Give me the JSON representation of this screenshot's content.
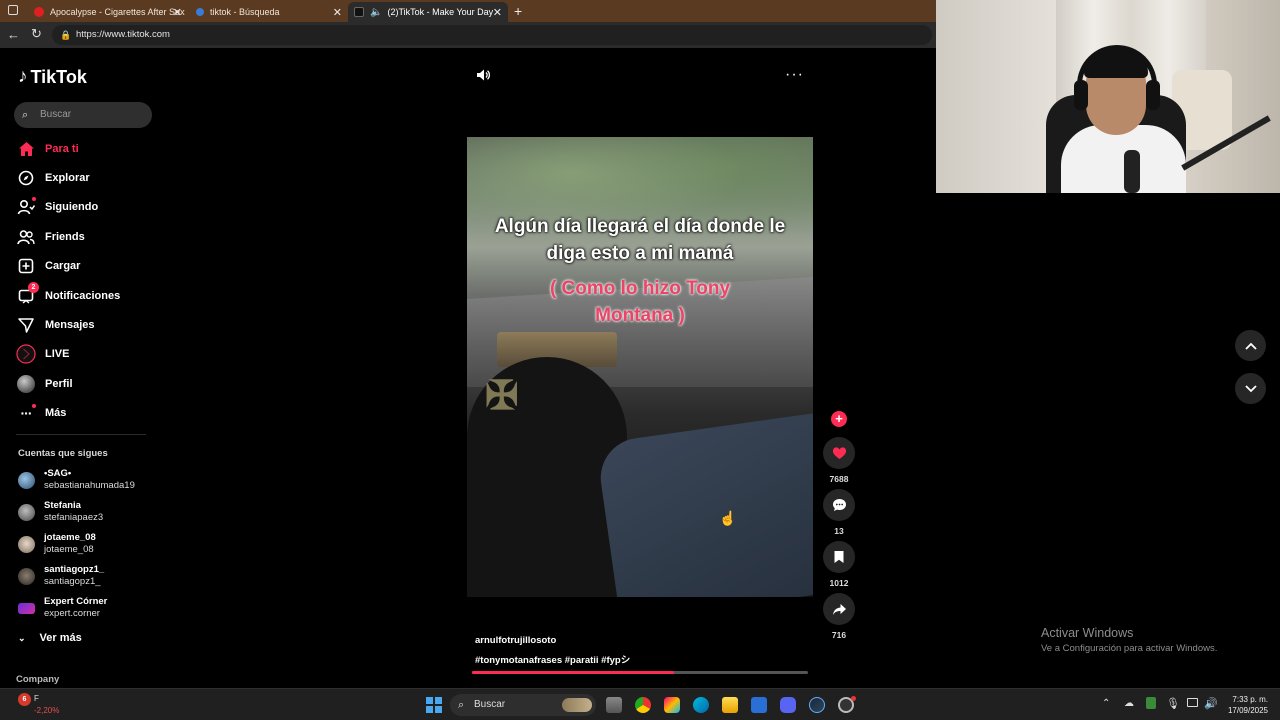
{
  "browser": {
    "tabs": [
      {
        "title": "Apocalypse - Cigarettes After Sex",
        "favicon_color": "#e02020"
      },
      {
        "title": "tiktok - Búsqueda",
        "favicon_color": "#3a7bd5"
      },
      {
        "title": "(2)TikTok - Make Your Day",
        "favicon_color": "#111111"
      }
    ],
    "url": "https://www.tiktok.com"
  },
  "sidebar": {
    "logo": "TikTok",
    "search_placeholder": "Buscar",
    "nav": [
      {
        "label": "Para ti",
        "icon": "home-icon",
        "active": true
      },
      {
        "label": "Explorar",
        "icon": "compass-icon"
      },
      {
        "label": "Siguiendo",
        "icon": "following-icon"
      },
      {
        "label": "Friends",
        "icon": "friends-icon"
      },
      {
        "label": "Cargar",
        "icon": "upload-icon"
      },
      {
        "label": "Notificaciones",
        "icon": "notifications-icon",
        "badge": "2"
      },
      {
        "label": "Mensajes",
        "icon": "messages-icon"
      },
      {
        "label": "LIVE",
        "icon": "live-icon"
      },
      {
        "label": "Perfil",
        "icon": "profile-avatar"
      },
      {
        "label": "Más",
        "icon": "more-icon"
      }
    ],
    "following_title": "Cuentas que sigues",
    "accounts": [
      {
        "name": "•SAG•",
        "username": "sebastianahumada19"
      },
      {
        "name": "Stefania",
        "username": "stefaniapaez3"
      },
      {
        "name": "jotaeme_08",
        "username": "jotaeme_08"
      },
      {
        "name": "santiagopz1_",
        "username": "santiagopz1_"
      },
      {
        "name": "Expert Córner",
        "username": "expert.corner"
      }
    ],
    "see_more": "Ver más",
    "company": "Company"
  },
  "video": {
    "caption_main": "Algún día llegará el día donde le diga esto a mi mamá",
    "caption_sub": "( Como lo hizo Tony Montana )",
    "author": "arnulfotrujillosoto",
    "hashtags": "#tonymotanafrases #paratii  #fypシ",
    "likes": "7688",
    "comments": "13",
    "saves": "1012",
    "shares": "716",
    "progress": 0.6
  },
  "watermark": {
    "line1": "Activar Windows",
    "line2": "Ve a Configuración para activar Windows."
  },
  "taskbar": {
    "weather_temp": "F",
    "weather_change": "-2,20%",
    "search_label": "Buscar",
    "time": "7:33 p. m.",
    "date": "17/09/2025"
  }
}
